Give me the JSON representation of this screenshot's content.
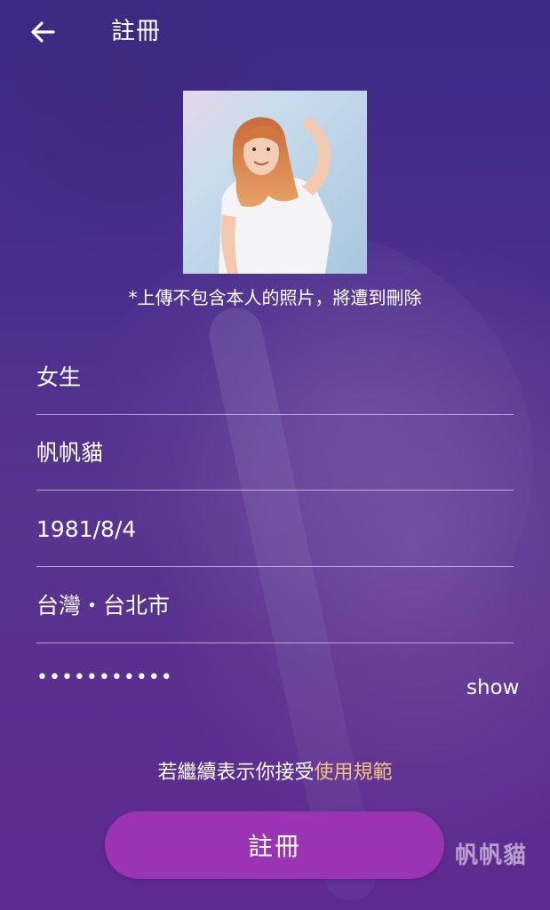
{
  "header": {
    "title": "註冊",
    "back_icon": "arrow-left-icon"
  },
  "photo": {
    "note": "*上傳不包含本人的照片，將遭到刪除"
  },
  "form": {
    "gender": "女生",
    "nickname": "帆帆貓",
    "birthday": "1981/8/4",
    "location": "台灣・台北市",
    "password_masked": "•••••••••••",
    "show_label": "show"
  },
  "terms": {
    "prefix": "若繼續表示你接受",
    "link": "使用規範"
  },
  "actions": {
    "register_label": "註冊"
  },
  "watermark": "帆帆貓",
  "colors": {
    "button": "#9b33b5",
    "link": "#f4c27f",
    "background_top": "#3d2a86",
    "background_bottom": "#5e2a90"
  }
}
